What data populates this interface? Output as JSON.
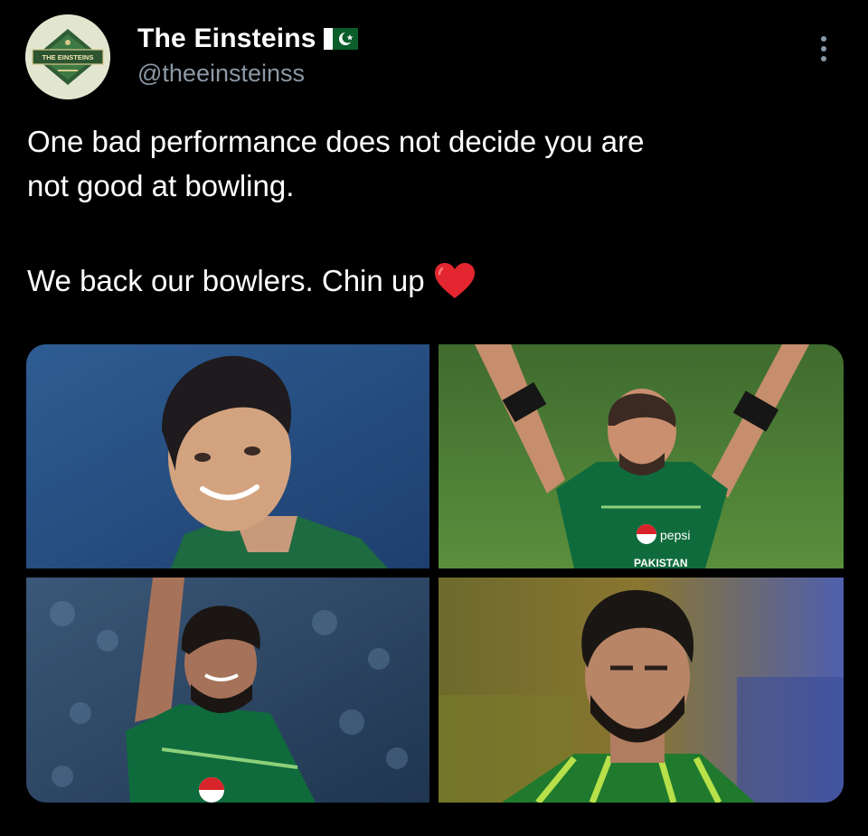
{
  "author": {
    "display_name": "The Einsteins",
    "handle": "@theeinsteinss",
    "avatar_text": "THE EINSTEINS",
    "verified_flag": "pakistan-flag-icon"
  },
  "menu": {
    "icon": "more-options-icon"
  },
  "tweet": {
    "line1": "One bad performance does not decide you are",
    "line2": "not good at bowling.",
    "line3": "We back our bowlers. Chin up",
    "emoji": "red-heart-icon"
  },
  "media": {
    "photo_count": 4,
    "photos": [
      {
        "icon": "player-photo-1"
      },
      {
        "icon": "player-photo-2",
        "jersey_text": "PAKISTAN",
        "sponsor": "pepsi"
      },
      {
        "icon": "player-photo-3"
      },
      {
        "icon": "player-photo-4"
      }
    ]
  },
  "colors": {
    "background": "#000000",
    "text": "#ffffff",
    "secondary_text": "#8b98a5",
    "heart": "#e3262f",
    "jersey_green": "#0f6b3c"
  }
}
